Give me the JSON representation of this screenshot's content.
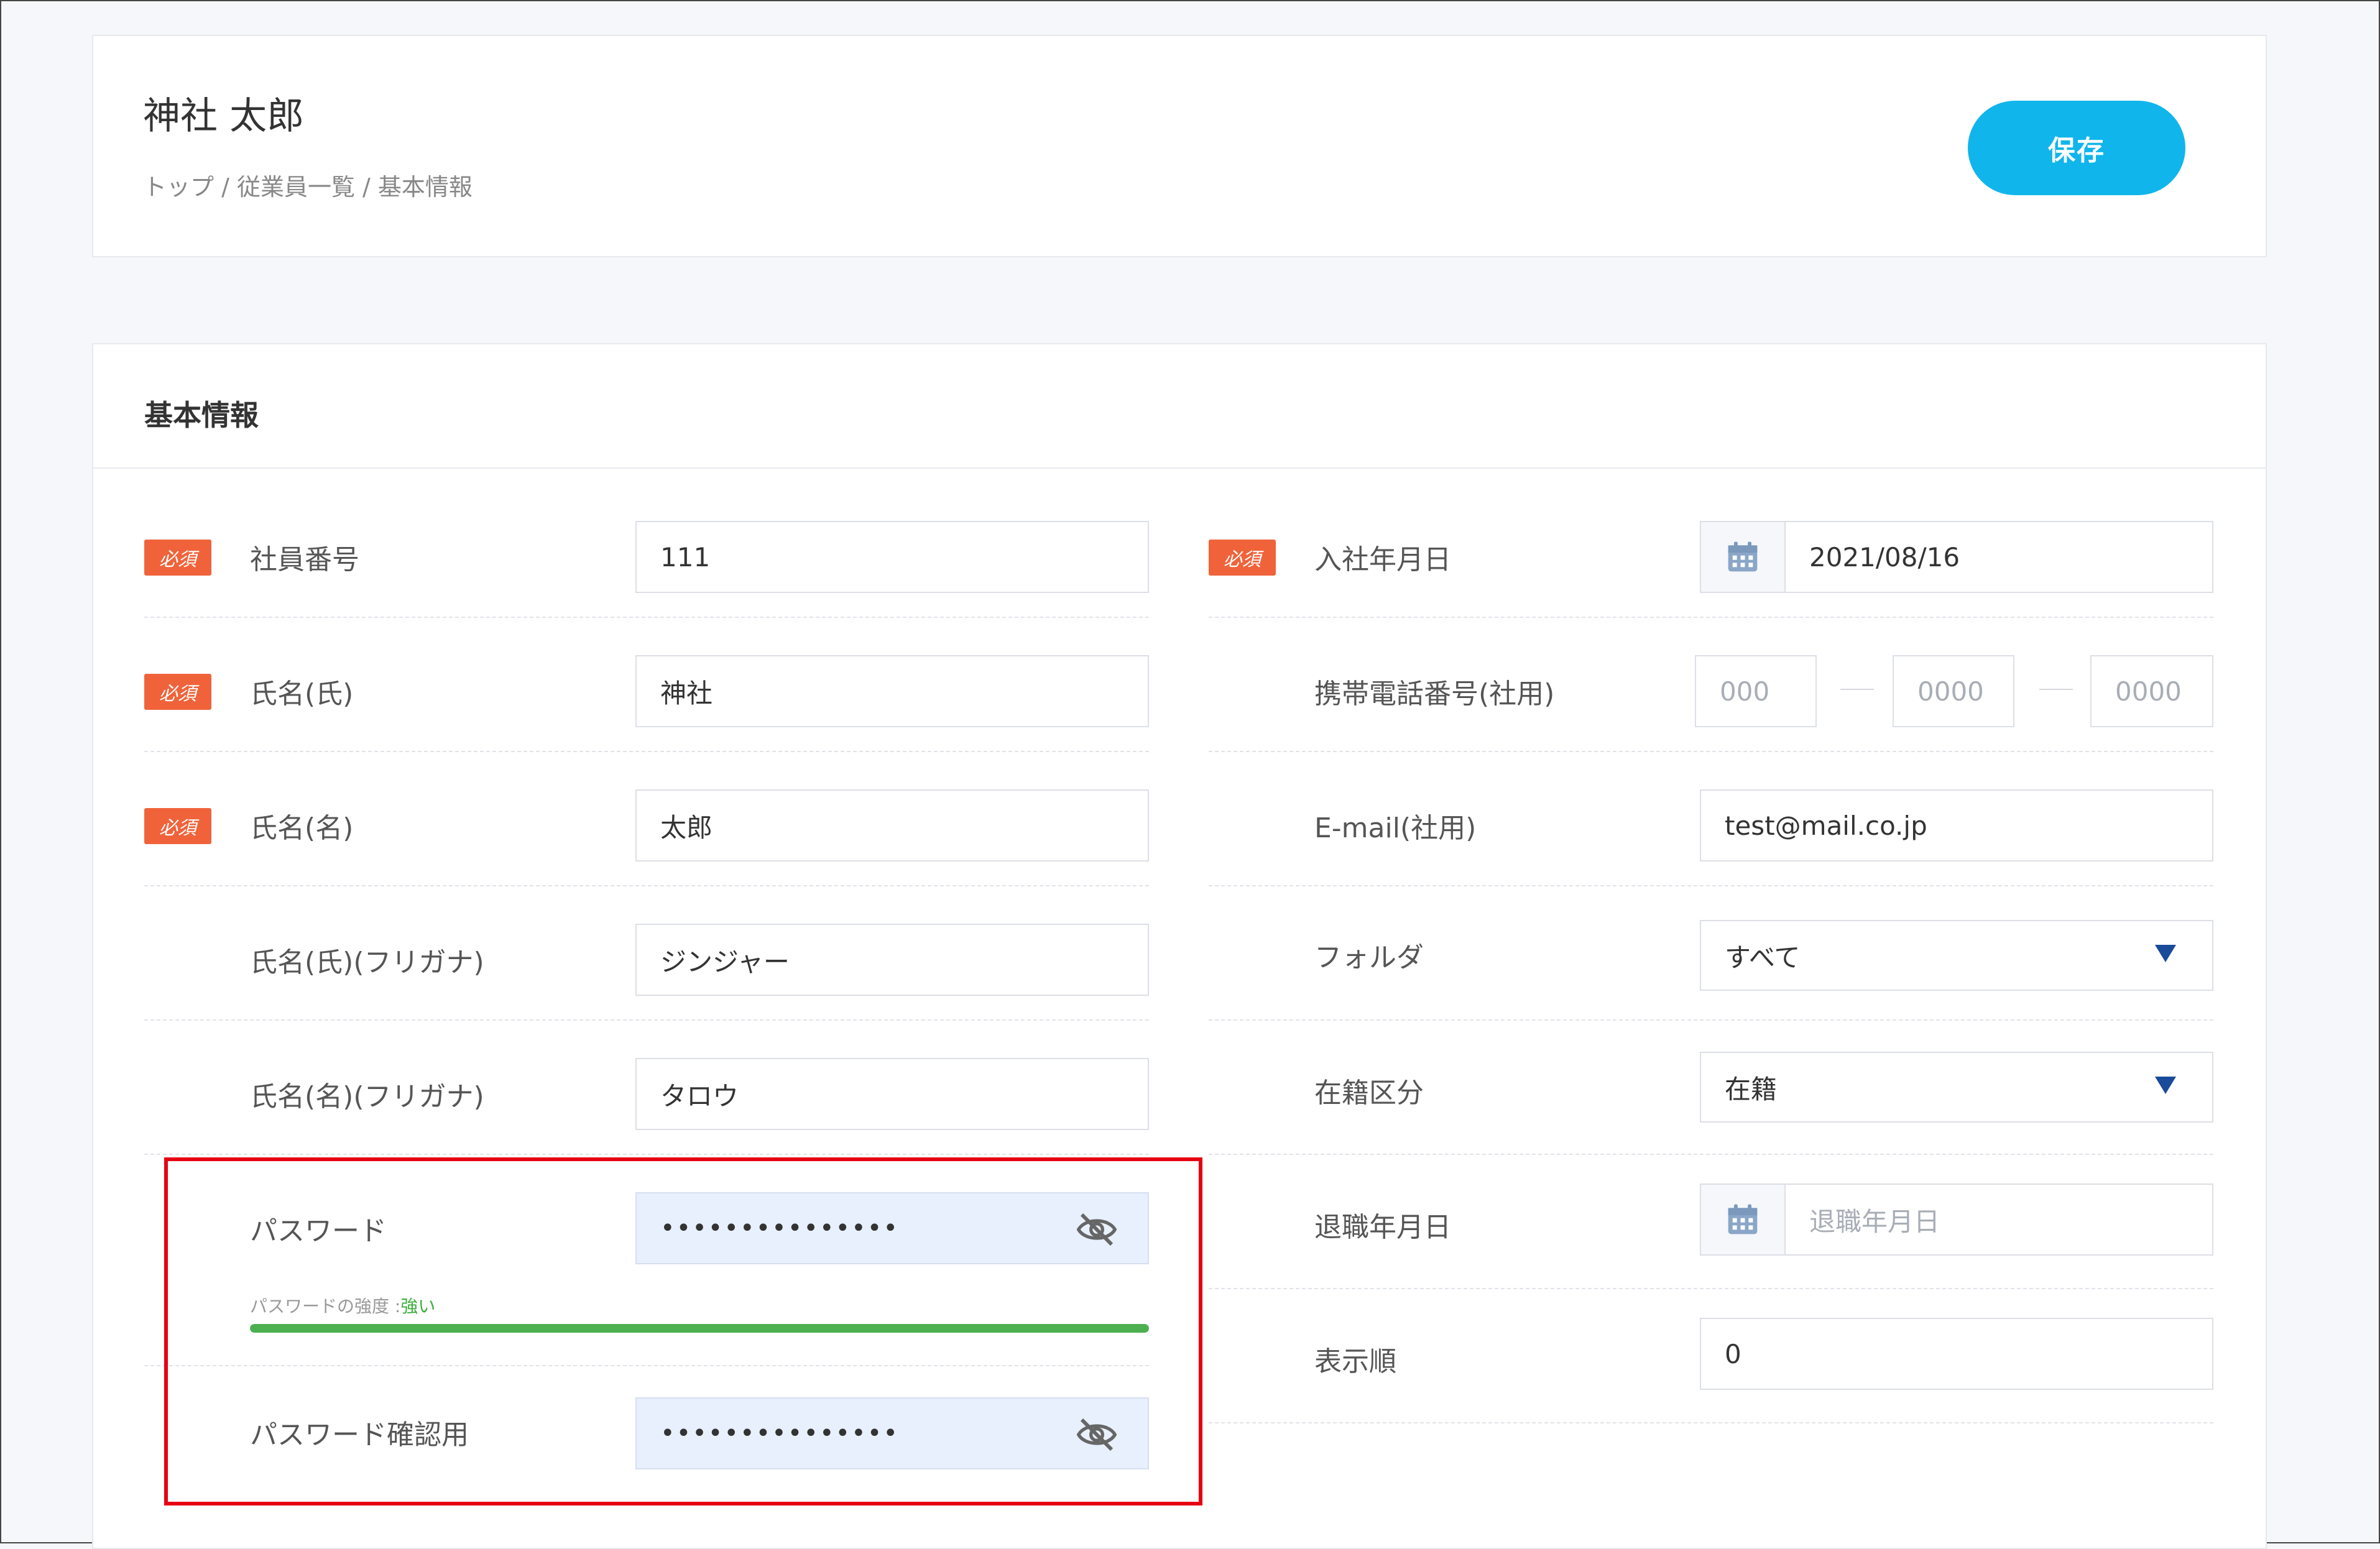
{
  "header": {
    "title": "神社 太郎",
    "breadcrumb": "トップ / 従業員一覧 / 基本情報",
    "save_label": "保存"
  },
  "section": {
    "title": "基本情報",
    "required_label": "必須"
  },
  "left_fields": {
    "employee_number": {
      "label": "社員番号",
      "value": "111"
    },
    "last_name": {
      "label": "氏名(氏)",
      "value": "神社"
    },
    "first_name": {
      "label": "氏名(名)",
      "value": "太郎"
    },
    "last_name_kana": {
      "label": "氏名(氏)(フリガナ)",
      "value": "ジンジャー"
    },
    "first_name_kana": {
      "label": "氏名(名)(フリガナ)",
      "value": "タロウ"
    },
    "password": {
      "label": "パスワード",
      "value": "•••••••••••••••"
    },
    "password_strength": {
      "label": "パスワードの強度 :",
      "level": "強い",
      "fill": 1.0
    },
    "password_confirm": {
      "label": "パスワード確認用",
      "value": "•••••••••••••••"
    }
  },
  "right_fields": {
    "hire_date": {
      "label": "入社年月日",
      "value": "2021/08/16"
    },
    "mobile": {
      "label": "携帯電話番号(社用)",
      "part1": "000",
      "part2": "0000",
      "part3": "0000"
    },
    "email": {
      "label": "E-mail(社用)",
      "value": "test@mail.co.jp"
    },
    "folder": {
      "label": "フォルダ",
      "value": "すべて"
    },
    "status": {
      "label": "在籍区分",
      "value": "在籍"
    },
    "retire_date": {
      "label": "退職年月日",
      "placeholder": "退職年月日"
    },
    "display_order": {
      "label": "表示順",
      "value": "0"
    }
  },
  "icons": {
    "calendar": "calendar-icon",
    "eye_off": "eye-off-icon",
    "dropdown": "chevron-down-icon"
  },
  "colors": {
    "accent": "#10b5ec",
    "required": "#f0633a",
    "strength": "#4caf50",
    "highlight": "#e60012"
  }
}
